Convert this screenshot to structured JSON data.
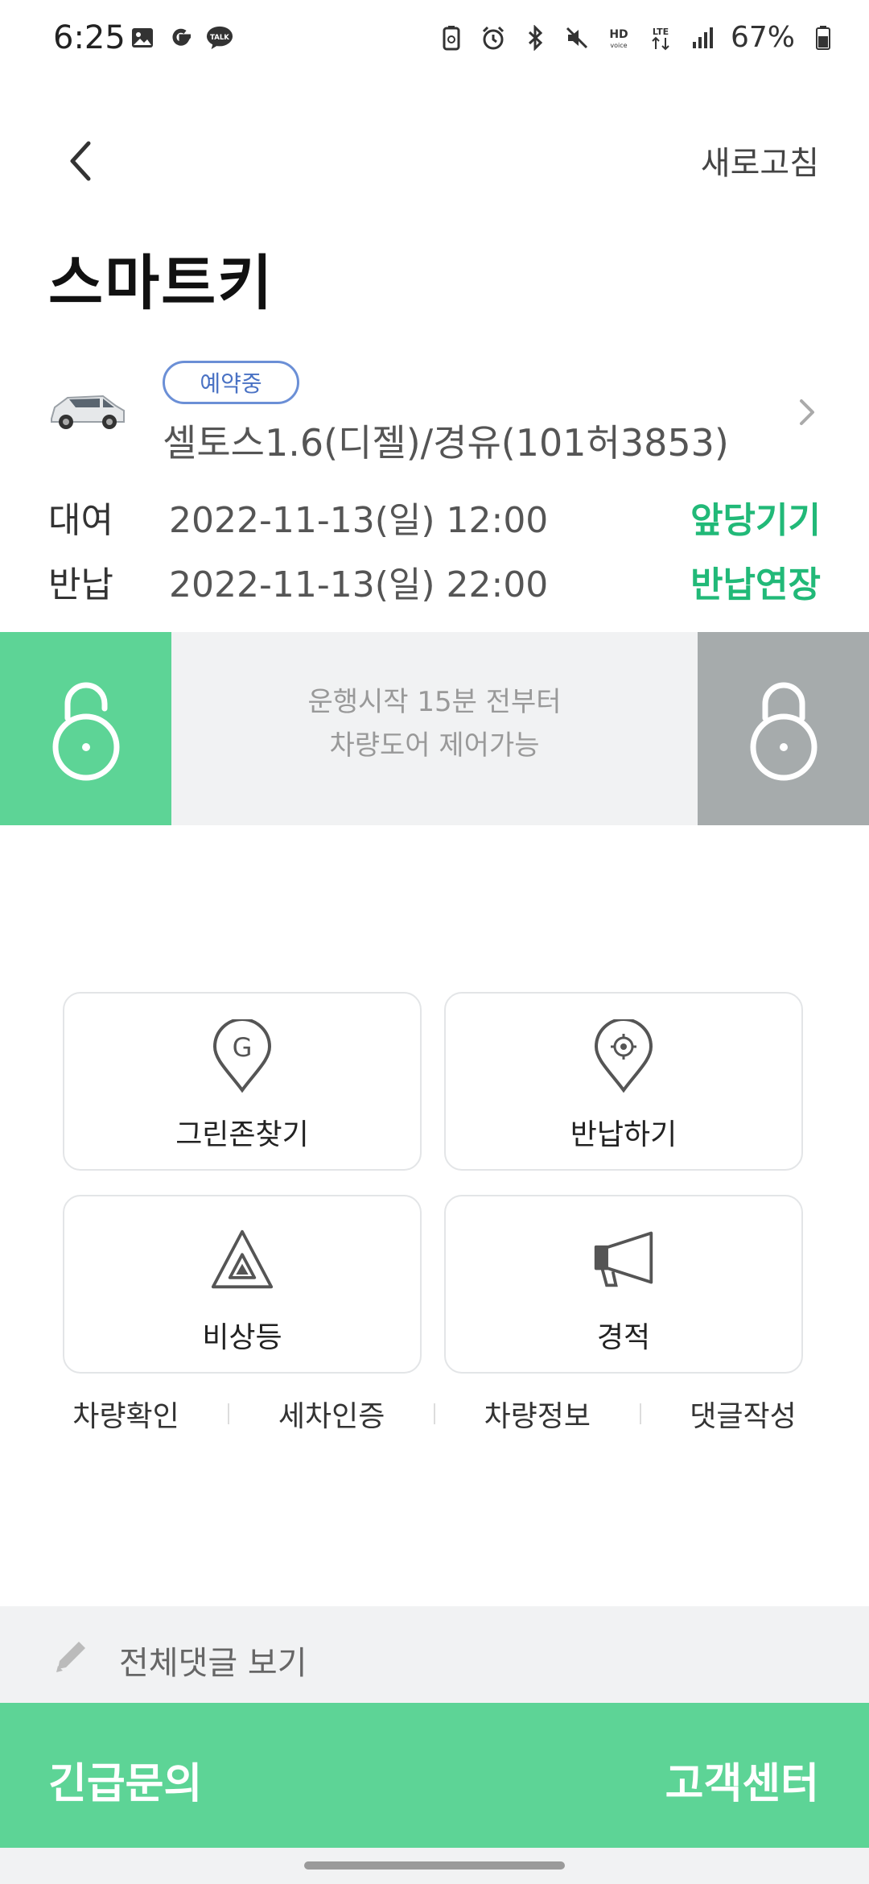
{
  "status_bar": {
    "time": "6:25",
    "left_icons": [
      "gallery-icon",
      "google-icon",
      "kakaotalk-icon"
    ],
    "right_icons": [
      "battery-saver-icon",
      "alarm-icon",
      "bluetooth-icon",
      "mute-icon",
      "hd-voice-icon",
      "lte-icon",
      "signal-icon"
    ],
    "battery": "67%"
  },
  "header": {
    "refresh_label": "새로고침",
    "title": "스마트키"
  },
  "car": {
    "status_badge": "예약중",
    "name": "셀토스1.6(디젤)/경유(101허3853)"
  },
  "rental": {
    "rent_label": "대여",
    "rent_time": "2022-11-13(일) 12:00",
    "rent_action": "앞당기기",
    "return_label": "반납",
    "return_time": "2022-11-13(일) 22:00",
    "return_action": "반납연장"
  },
  "lock_panel": {
    "notice_line1": "운행시작 15분 전부터",
    "notice_line2": "차량도어 제어가능",
    "colors": {
      "unlock": "#5dd496",
      "lock": "#a6abac"
    }
  },
  "menu": {
    "find_greenzone": "그린존찾기",
    "return_car": "반납하기",
    "hazard_lights": "비상등",
    "horn": "경적"
  },
  "links": {
    "check_car": "차량확인",
    "wash_verify": "세차인증",
    "car_info": "차량정보",
    "write_comment": "댓글작성"
  },
  "comments": {
    "label": "전체댓글 보기"
  },
  "bottom": {
    "emergency": "긴급문의",
    "support": "고객센터",
    "accent": "#5dd496"
  }
}
